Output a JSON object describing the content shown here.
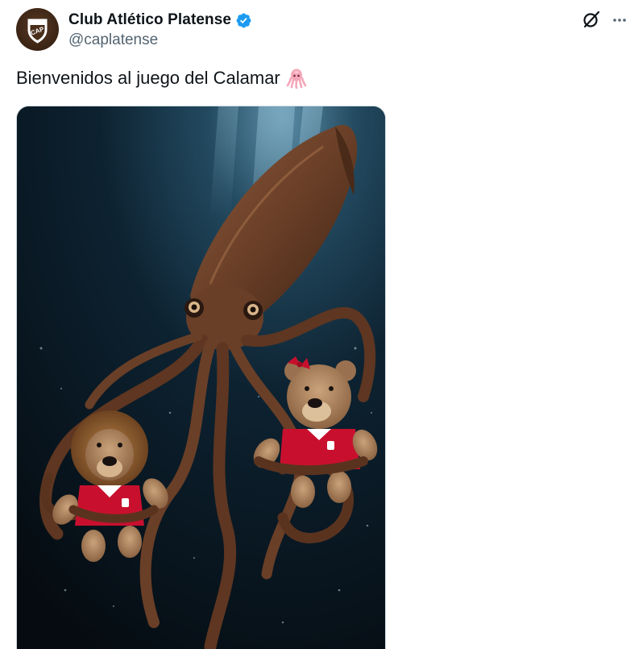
{
  "author": {
    "display_name": "Club Atlético Platense",
    "handle": "@caplatense",
    "avatar_text": "CAP",
    "verified": true
  },
  "tweet": {
    "text": "Bienvenidos al juego del Calamar",
    "emoji": "squid-emoji"
  },
  "icons": {
    "grok": "grok-icon",
    "more": "more-icon",
    "verified": "verified-badge-icon"
  },
  "colors": {
    "text_primary": "#0f1419",
    "text_secondary": "#536471",
    "verified_blue": "#1d9bf0",
    "avatar_brown": "#3b2414",
    "jersey_red": "#c8102e"
  }
}
